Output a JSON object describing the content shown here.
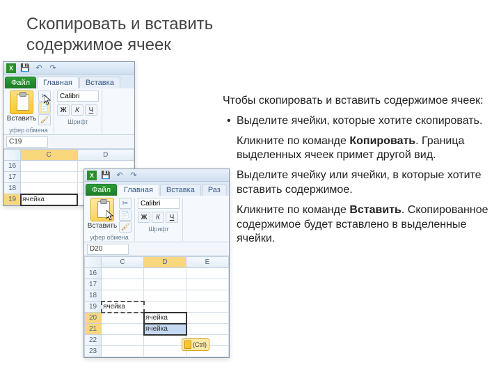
{
  "title": "Скопировать и вставить содержимое ячеек",
  "intro": "Чтобы скопировать и вставить содержимое ячеек:",
  "steps": [
    {
      "text": "Выделите ячейки, которые хотите скопировать."
    },
    {
      "pre": "Кликните по команде ",
      "bold": "Копировать",
      "post": ". Граница выделенных ячеек примет другой вид."
    },
    {
      "text": "Выделите ячейку или ячейки, в которые хотите вставить содержимое."
    },
    {
      "pre": "Кликните по команде ",
      "bold": "Вставить",
      "post": ". Скопированное содержимое будет вставлено в выделенные ячейки."
    }
  ],
  "excel": {
    "file_tab": "Файл",
    "tab_home": "Главная",
    "tab_insert": "Вставка",
    "tab_layout": "Раз",
    "paste_label": "Вставить",
    "clipboard_group": "уфер обмена",
    "font_group": "Шрифт",
    "font_name": "Calibri",
    "bold": "Ж",
    "italic": "К",
    "underline": "Ч",
    "namebox1": "C19",
    "namebox2": "D20",
    "col_a": "",
    "cols1": [
      "C",
      "D"
    ],
    "cols2": [
      "C",
      "D",
      "E"
    ],
    "rows1": [
      16,
      17,
      18,
      19
    ],
    "rows2": [
      16,
      17,
      18,
      19,
      20,
      21,
      22,
      23
    ],
    "cell_text": "ячейка",
    "ctrl_tag": "(Ctrl)"
  }
}
